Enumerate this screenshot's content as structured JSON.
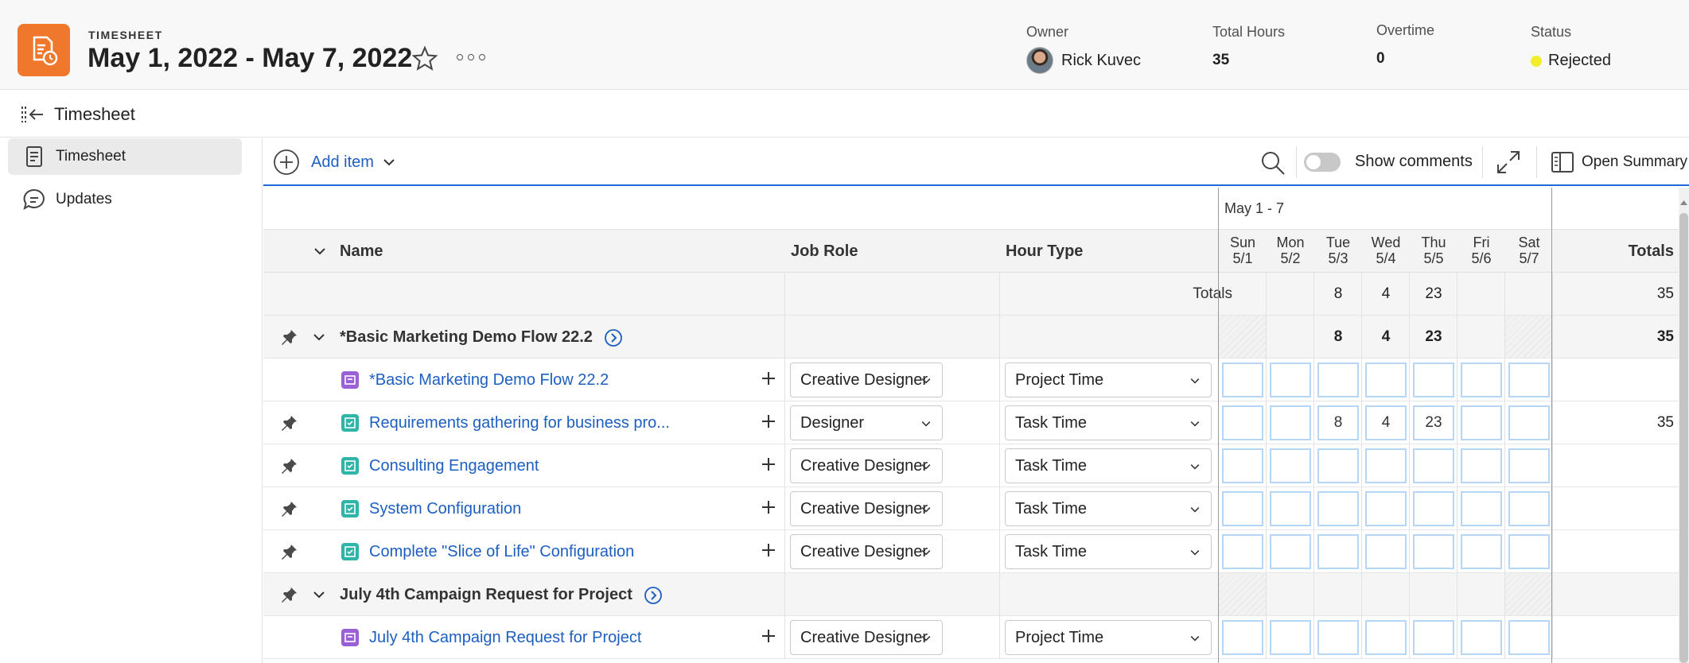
{
  "header": {
    "kicker": "TIMESHEET",
    "title": "May 1, 2022 - May 7, 2022",
    "owner_label": "Owner",
    "owner_name": "Rick Kuvec",
    "total_hours_label": "Total Hours",
    "total_hours_value": "35",
    "overtime_label": "Overtime",
    "overtime_value": "0",
    "status_label": "Status",
    "status_value": "Rejected",
    "status_color": "#f3ee2b",
    "logo_color": "#f0782d"
  },
  "subbar": {
    "title": "Timesheet"
  },
  "sidebar": {
    "items": [
      {
        "label": "Timesheet",
        "icon": "document-icon",
        "active": true
      },
      {
        "label": "Updates",
        "icon": "chat-bubble-icon",
        "active": false
      }
    ]
  },
  "toolbar": {
    "add_item_label": "Add item",
    "show_comments_label": "Show comments",
    "open_summary_label": "Open Summary"
  },
  "grid": {
    "week_label": "May 1 - 7",
    "columns": {
      "name": "Name",
      "job_role": "Job Role",
      "hour_type": "Hour Type",
      "totals": "Totals"
    },
    "days": [
      {
        "name": "Sun",
        "date": "5/1"
      },
      {
        "name": "Mon",
        "date": "5/2"
      },
      {
        "name": "Tue",
        "date": "5/3"
      },
      {
        "name": "Wed",
        "date": "5/4"
      },
      {
        "name": "Thu",
        "date": "5/5"
      },
      {
        "name": "Fri",
        "date": "5/6"
      },
      {
        "name": "Sat",
        "date": "5/7"
      }
    ],
    "totals_row": {
      "label": "Totals",
      "values": [
        "",
        "",
        "8",
        "4",
        "23",
        "",
        ""
      ],
      "total": "35"
    },
    "groups": [
      {
        "name": "*Basic Marketing Demo Flow 22.2",
        "values": [
          "",
          "",
          "8",
          "4",
          "23",
          "",
          ""
        ],
        "total": "35",
        "items": [
          {
            "name": "*Basic Marketing Demo Flow 22.2",
            "icon": "project-icon",
            "job_role": "Creative Designer",
            "hour_type": "Project Time",
            "values": [
              "",
              "",
              "",
              "",
              "",
              "",
              ""
            ],
            "total": "",
            "pinned": false
          },
          {
            "name": "Requirements gathering for business pro...",
            "icon": "task-icon",
            "job_role": "Designer",
            "hour_type": "Task Time",
            "values": [
              "",
              "",
              "8",
              "4",
              "23",
              "",
              ""
            ],
            "total": "35",
            "pinned": true
          },
          {
            "name": "Consulting Engagement",
            "icon": "task-icon",
            "job_role": "Creative Designer",
            "hour_type": "Task Time",
            "values": [
              "",
              "",
              "",
              "",
              "",
              "",
              ""
            ],
            "total": "",
            "pinned": true
          },
          {
            "name": "System Configuration",
            "icon": "task-icon",
            "job_role": "Creative Designer",
            "hour_type": "Task Time",
            "values": [
              "",
              "",
              "",
              "",
              "",
              "",
              ""
            ],
            "total": "",
            "pinned": true
          },
          {
            "name": "Complete \"Slice of Life\" Configuration",
            "icon": "task-icon",
            "job_role": "Creative Designer",
            "hour_type": "Task Time",
            "values": [
              "",
              "",
              "",
              "",
              "",
              "",
              ""
            ],
            "total": "",
            "pinned": true
          }
        ]
      },
      {
        "name": "July 4th Campaign Request for Project",
        "values": [
          "",
          "",
          "",
          "",
          "",
          "",
          ""
        ],
        "total": "",
        "items": [
          {
            "name": "July 4th Campaign Request for Project",
            "icon": "project-icon",
            "job_role": "Creative Designer",
            "hour_type": "Project Time",
            "values": [
              "",
              "",
              "",
              "",
              "",
              "",
              ""
            ],
            "total": "",
            "pinned": false
          }
        ]
      }
    ]
  }
}
